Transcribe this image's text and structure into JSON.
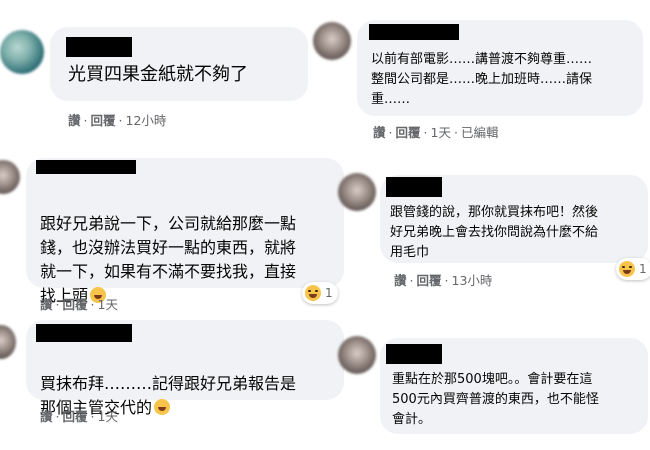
{
  "comments": [
    {
      "text": "光買四果金紙就不夠了",
      "actions": {
        "like": "讚",
        "reply": "回覆",
        "time": "12小時"
      }
    },
    {
      "text": "以前有部電影……講普渡不夠尊重……\n整間公司都是……晚上加班時……請保\n重……",
      "actions": {
        "like": "讚",
        "reply": "回覆",
        "time": "1天",
        "edited": "已編輯"
      }
    },
    {
      "text": "跟好兄弟說一下，公司就給那麼一點\n錢，也沒辦法買好一點的東西，就將\n就一下，如果有不滿不要找我，直接\n找上頭",
      "actions": {
        "like": "讚",
        "reply": "回覆",
        "time": "1天"
      },
      "reaction": {
        "icon": "laughing-emoji-icon",
        "count": "1"
      }
    },
    {
      "text": "跟管錢的說，那你就買抹布吧！然後\n好兄弟晚上會去找你問說為什麼不給\n用毛巾",
      "actions": {
        "like": "讚",
        "reply": "回覆",
        "time": "13小時"
      },
      "reaction": {
        "icon": "laughing-emoji-icon",
        "count": "1"
      }
    },
    {
      "text": "買抹布拜………記得跟好兄弟報告是\n那個主管交代的",
      "actions": {
        "like": "讚",
        "reply": "回覆",
        "time": "1天"
      }
    },
    {
      "text": "重點在於那500塊吧。。會計要在這\n500元內買齊普渡的東西，也不能怪\n會計。"
    }
  ],
  "colors": {
    "bubble": "#f0f2f5",
    "meta": "#65676b",
    "text": "#050505",
    "emoji": "#f7c34a"
  }
}
